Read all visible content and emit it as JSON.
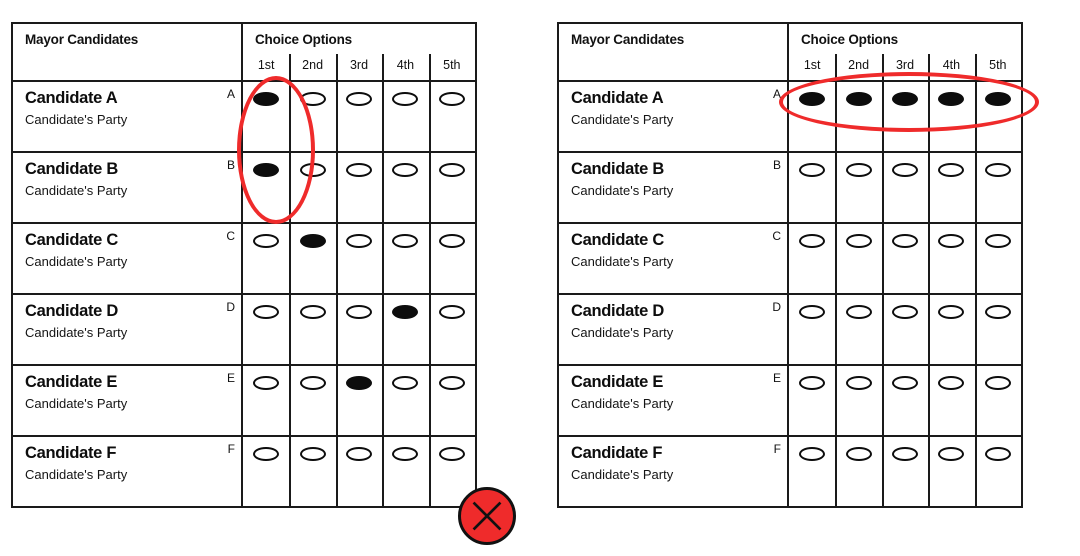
{
  "ballots": [
    {
      "id": "left",
      "header": {
        "name_column": "Mayor Candidates",
        "choice_column": "Choice Options",
        "ranks": [
          "1st",
          "2nd",
          "3rd",
          "4th",
          "5th"
        ]
      },
      "rows": [
        {
          "name": "Candidate A",
          "party": "Candidate's Party",
          "letter": "A",
          "marks": [
            true,
            false,
            false,
            false,
            false
          ]
        },
        {
          "name": "Candidate B",
          "party": "Candidate's Party",
          "letter": "B",
          "marks": [
            true,
            false,
            false,
            false,
            false
          ]
        },
        {
          "name": "Candidate C",
          "party": "Candidate's Party",
          "letter": "C",
          "marks": [
            false,
            true,
            false,
            false,
            false
          ]
        },
        {
          "name": "Candidate D",
          "party": "Candidate's Party",
          "letter": "D",
          "marks": [
            false,
            false,
            false,
            true,
            false
          ]
        },
        {
          "name": "Candidate E",
          "party": "Candidate's Party",
          "letter": "E",
          "marks": [
            false,
            false,
            true,
            false,
            false
          ]
        },
        {
          "name": "Candidate F",
          "party": "Candidate's Party",
          "letter": "F",
          "marks": [
            false,
            false,
            false,
            false,
            false
          ]
        }
      ],
      "annotation": {
        "shape": "ellipse",
        "target": "1st choice column, rows A and B",
        "color": "#ef2b2b"
      },
      "status_marker": {
        "icon": "x-mark-icon",
        "fill_color": "#ef2b2b",
        "stroke_color": "#111111",
        "meaning": "invalid ballot"
      }
    },
    {
      "id": "right",
      "header": {
        "name_column": "Mayor Candidates",
        "choice_column": "Choice Options",
        "ranks": [
          "1st",
          "2nd",
          "3rd",
          "4th",
          "5th"
        ]
      },
      "rows": [
        {
          "name": "Candidate A",
          "party": "Candidate's Party",
          "letter": "A",
          "marks": [
            true,
            true,
            true,
            true,
            true
          ]
        },
        {
          "name": "Candidate B",
          "party": "Candidate's Party",
          "letter": "B",
          "marks": [
            false,
            false,
            false,
            false,
            false
          ]
        },
        {
          "name": "Candidate C",
          "party": "Candidate's Party",
          "letter": "C",
          "marks": [
            false,
            false,
            false,
            false,
            false
          ]
        },
        {
          "name": "Candidate D",
          "party": "Candidate's Party",
          "letter": "D",
          "marks": [
            false,
            false,
            false,
            false,
            false
          ]
        },
        {
          "name": "Candidate E",
          "party": "Candidate's Party",
          "letter": "E",
          "marks": [
            false,
            false,
            false,
            false,
            false
          ]
        },
        {
          "name": "Candidate F",
          "party": "Candidate's Party",
          "letter": "F",
          "marks": [
            false,
            false,
            false,
            false,
            false
          ]
        }
      ],
      "annotation": {
        "shape": "ellipse",
        "target": "Candidate A row, all five choice columns",
        "color": "#ef2b2b"
      },
      "status_marker": {
        "icon": "x-mark-icon",
        "fill_color": "#ef2b2b",
        "stroke_color": "#111111",
        "meaning": "invalid ballot"
      }
    }
  ],
  "colors": {
    "annotation_red": "#ef2b2b",
    "ink_black": "#0d0d0d",
    "paper_white": "#ffffff"
  }
}
